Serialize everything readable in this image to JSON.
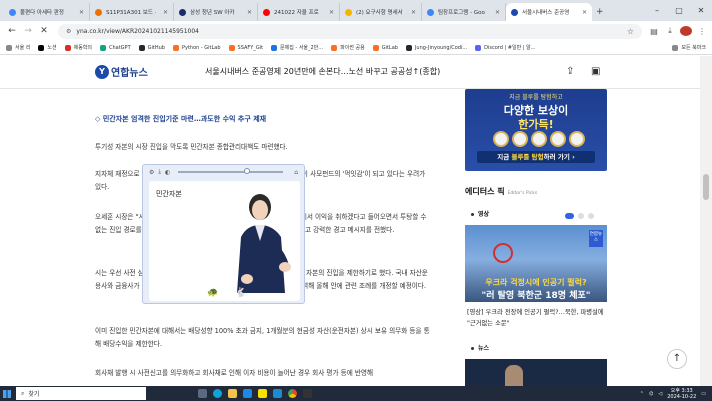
{
  "tabs": [
    {
      "label": "불편다 아세타 판정",
      "color": "#4285f4"
    },
    {
      "label": "S11P31A301 보드 ·",
      "color": "#e8710a"
    },
    {
      "label": "삼성 청년 SW 아카",
      "color": "#1a2d6b"
    },
    {
      "label": "241022 자율 프로",
      "color": "#ff0000"
    },
    {
      "label": "(2) 요구사항 명세서",
      "color": "#f4b400"
    },
    {
      "label": "팀장프로그램 - Goo",
      "color": "#4285f4"
    },
    {
      "label": "서울시내버스 준공영",
      "color": "#1c4aa8",
      "active": true
    }
  ],
  "address": {
    "url": "yna.co.kr/view/AKR20241021145951004"
  },
  "bookmarks": [
    {
      "label": "서울 리",
      "color": "#888"
    },
    {
      "label": "노션",
      "color": "#000"
    },
    {
      "label": "제동학의",
      "color": "#d93025"
    },
    {
      "label": "ChatGPT",
      "color": "#10a37f"
    },
    {
      "label": "GitHub",
      "color": "#24292e"
    },
    {
      "label": "Python - GitLab",
      "color": "#fc6d26"
    },
    {
      "label": "SSAFY_Git",
      "color": "#fc6d26"
    },
    {
      "label": "문제집 - 서울_2반...",
      "color": "#1a73e8"
    },
    {
      "label": "파이썬 공용",
      "color": "#fc6d26"
    },
    {
      "label": "GitLab",
      "color": "#fc6d26"
    },
    {
      "label": "Jung-Jinyoung/Codi...",
      "color": "#24292e"
    },
    {
      "label": "Discord | #일반 | 알...",
      "color": "#5865f2"
    }
  ],
  "bookmarks_other": "모든 북마크",
  "site": {
    "logo_text": "연합뉴스",
    "headline": "서울시내버스 준공영제 20년만에 손본다…노선 바꾸고 공공성↑(종합)"
  },
  "article": {
    "subhead": "◇ 민간자본 엄격한 진입기준 마련…과도한 수익 추구 제재",
    "p1": "투기성 자본의 시장 진입을 막도록 민간자본 종합관리대책도 마련했다.",
    "p2": "지자체 재정으로 운영하는 준공영제 특성상 투기 자본이 서울 시내버스 시장이 사모펀드의 '먹잇감'이 되고 있다는 우려가 있다.",
    "p3": "오세훈 시장은 \"시민들의 세금으로 운영되는 공공재적 성격의 버스운송사업에서 이익을 취하겠다고 들어오면서 투탕할 수 없는 진입 경로를 감안한 조건을 충족시키지 못하면 들어오지 못하게 하겠다\"고 강력한 경고 메시지를 전했다.",
    "p4": "시는 우선 사전 심사 제도를 도입하고 투기자본의 과도한 수익률에 의한 추구 자본의 진입을 제한하기로 했다. 국내 자산운용사와 금융사가 지분을 확보하고 고 더 엄격한 진입을 준다. 또 시의회와 협력해 올해 안에 관련 조례를 개정할 예정이다.",
    "p5": "이미 진입한 민간자본에 대해서는 배당성향 100% 초과 금지, 1개월분의 현금성 자산(운전자본) 상시 보유 의무화 등을 통해 배당수익을 제한한다.",
    "p6": "회사채 발행 시 사전신고를 의무화하고 회사채로 인해 이자 비용이 늘어난 경우 회사 평가 등에 반영해"
  },
  "sign_popup": {
    "word": "민간자본",
    "speed_level": 0.65
  },
  "sidebar": {
    "ad": {
      "small": "지금 블루를 탐험하고",
      "line1": "다양한 보상이",
      "line2": "한가득!",
      "cta_prefix": "지금 ",
      "cta_highlight": "블루를 탐험",
      "cta_suffix": "하러 가기 ›"
    },
    "pick_title": "에디터스 픽",
    "pick_sub": "Editor's Picks",
    "cat_video": "영상",
    "cat_news": "뉴스",
    "carousel_active": 1,
    "news_tag": "연합뉴스",
    "news_cap1": "우크라 걱정시에 인공기 펄럭?",
    "news_cap2": "\"러 탈영 북한군 18명 체포\"",
    "news_text": "[영상] 우크라 전장에 인공기 펄럭?…북한, 파병설에 \"근거없는 소문\""
  },
  "taskbar": {
    "search_placeholder": "찾기",
    "time": "오후 3:33",
    "date": "2024-10-22"
  }
}
